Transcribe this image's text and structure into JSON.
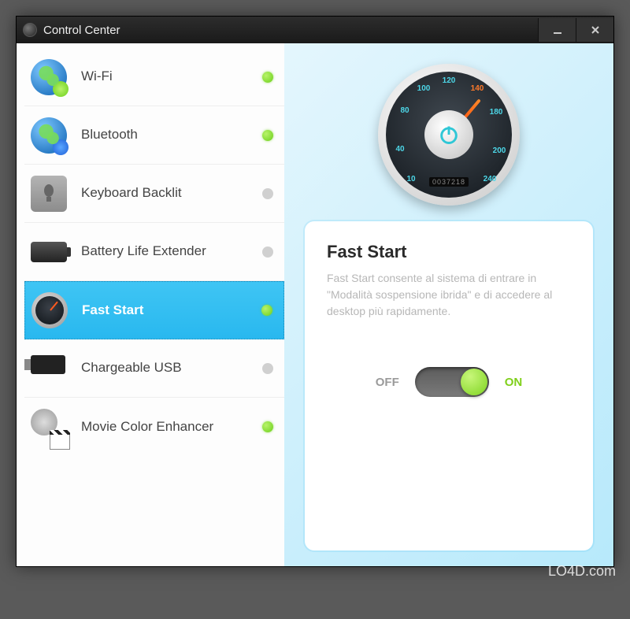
{
  "window": {
    "title": "Control Center"
  },
  "sidebar": {
    "items": [
      {
        "label": "Wi-Fi",
        "status": "on",
        "selected": false,
        "icon": "globe-wifi"
      },
      {
        "label": "Bluetooth",
        "status": "on",
        "selected": false,
        "icon": "globe-bluetooth"
      },
      {
        "label": "Keyboard Backlit",
        "status": "off",
        "selected": false,
        "icon": "keyboard"
      },
      {
        "label": "Battery Life Extender",
        "status": "off",
        "selected": false,
        "icon": "battery"
      },
      {
        "label": "Fast Start",
        "status": "on",
        "selected": true,
        "icon": "gauge"
      },
      {
        "label": "Chargeable USB",
        "status": "off",
        "selected": false,
        "icon": "usb"
      },
      {
        "label": "Movie Color Enhancer",
        "status": "on",
        "selected": false,
        "icon": "movie"
      }
    ]
  },
  "gauge": {
    "ticks": [
      "10",
      "40",
      "80",
      "100",
      "120",
      "140",
      "180",
      "200",
      "240"
    ],
    "odometer": "0037218"
  },
  "detail": {
    "title": "Fast Start",
    "description": "Fast Start consente al sistema di entrare in \"Modalità sospensione ibrida\" e di accedere al desktop più rapidamente.",
    "toggle": {
      "off_label": "OFF",
      "on_label": "ON",
      "value": "on"
    }
  },
  "watermark": "LO4D.com"
}
